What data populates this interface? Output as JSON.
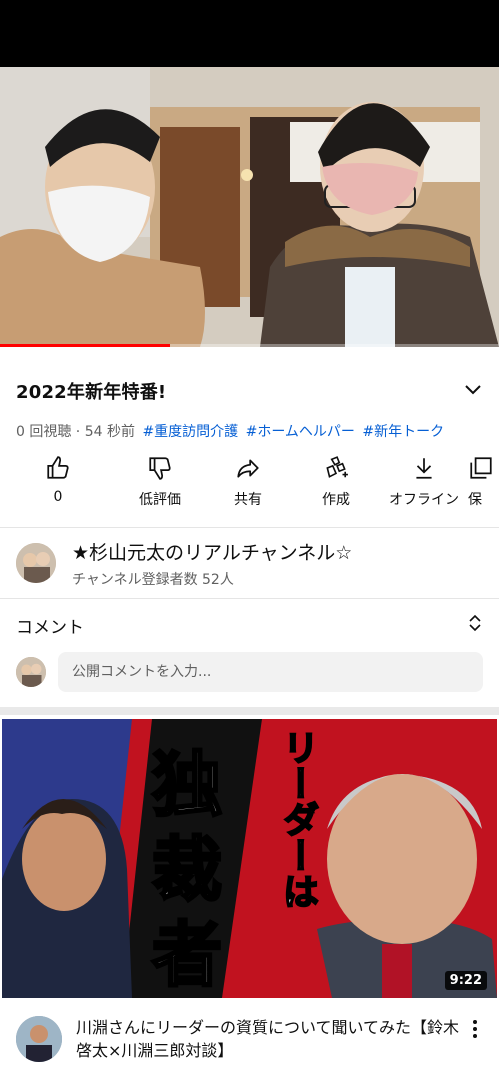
{
  "video": {
    "title": "2022年新年特番!",
    "views": "0 回視聴",
    "age": "54 秒前",
    "tags": [
      "#重度訪問介護",
      "#ホームヘルパー",
      "#新年トーク"
    ],
    "progress_fraction": 0.34
  },
  "actions": [
    {
      "icon": "thumbs-up-icon",
      "label": "0"
    },
    {
      "icon": "thumbs-down-icon",
      "label": "低評価"
    },
    {
      "icon": "share-icon",
      "label": "共有"
    },
    {
      "icon": "create-icon",
      "label": "作成"
    },
    {
      "icon": "download-icon",
      "label": "オフライン"
    },
    {
      "icon": "save-icon",
      "label": "保"
    }
  ],
  "channel": {
    "name": "★杉山元太のリアルチャンネル☆",
    "subscribers": "チャンネル登録者数 52人"
  },
  "comments": {
    "header": "コメント",
    "placeholder": "公開コメントを入力..."
  },
  "recommended": {
    "duration": "9:22",
    "title": "川淵さんにリーダーの資質について聞いてみた【鈴木啓太×川淵三郎対談】",
    "thumb_text": {
      "top": "リーダーは",
      "chars": [
        "独",
        "裁",
        "者"
      ]
    }
  }
}
